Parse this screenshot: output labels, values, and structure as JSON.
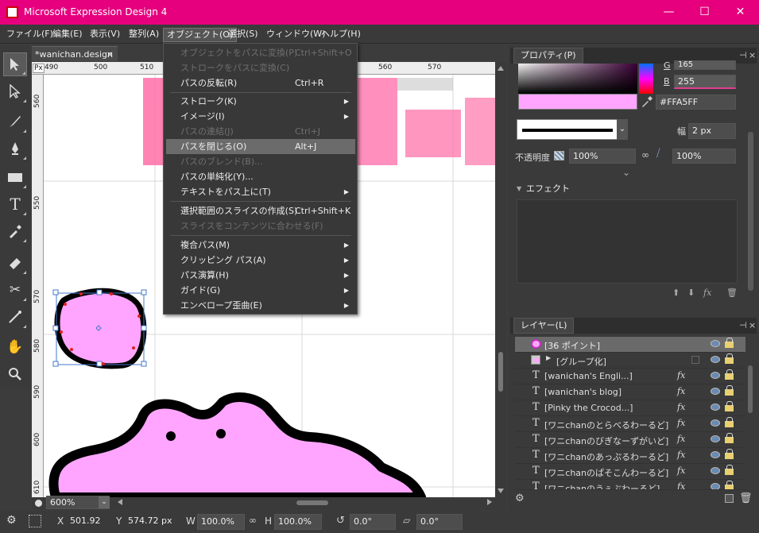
{
  "window": {
    "title": "Microsoft Expression Design 4",
    "minimize": "—",
    "maximize": "☐",
    "close": "✕"
  },
  "menu": [
    "ファイル(F)",
    "編集(E)",
    "表示(V)",
    "整列(A)",
    "オブジェクト(O)",
    "選択(S)",
    "ウィンドウ(W)",
    "ヘルプ(H)"
  ],
  "document": {
    "tab": "*wanichan.design",
    "close": "×",
    "ruler_origin": "Px"
  },
  "ruler_h": [
    "490",
    "500",
    "510",
    "560",
    "570"
  ],
  "ruler_v": [
    "560",
    "550",
    "570",
    "580",
    "590",
    "600",
    "610"
  ],
  "dropdown": {
    "items": [
      {
        "label": "オブジェクトをパスに変換(P)",
        "shortcut": "Ctrl+Shift+O",
        "disabled": true
      },
      {
        "label": "ストロークをパスに変換(C)",
        "shortcut": "",
        "disabled": true
      },
      {
        "label": "パスの反転(R)",
        "shortcut": "Ctrl+R",
        "disabled": false
      },
      {
        "label": "ストローク(K)",
        "shortcut": "",
        "disabled": false,
        "submenu": true
      },
      {
        "label": "イメージ(I)",
        "shortcut": "",
        "disabled": false,
        "submenu": true
      },
      {
        "label": "パスの連結(J)",
        "shortcut": "Ctrl+J",
        "disabled": true
      },
      {
        "label": "パスを閉じる(O)",
        "shortcut": "Alt+J",
        "disabled": false,
        "highlighted": true
      },
      {
        "label": "パスのブレンド(B)...",
        "shortcut": "",
        "disabled": true
      },
      {
        "label": "パスの単純化(Y)...",
        "shortcut": "",
        "disabled": false
      },
      {
        "label": "テキストをパス上に(T)",
        "shortcut": "",
        "disabled": false,
        "submenu": true
      },
      {
        "label": "選択範囲のスライスの作成(S)",
        "shortcut": "Ctrl+Shift+K",
        "disabled": false
      },
      {
        "label": "スライスをコンテンツに合わせる(F)",
        "shortcut": "",
        "disabled": true
      },
      {
        "label": "複合パス(M)",
        "shortcut": "",
        "disabled": false,
        "submenu": true
      },
      {
        "label": "クリッピング パス(A)",
        "shortcut": "",
        "disabled": false,
        "submenu": true
      },
      {
        "label": "パス演算(H)",
        "shortcut": "",
        "disabled": false,
        "submenu": true
      },
      {
        "label": "ガイド(G)",
        "shortcut": "",
        "disabled": false,
        "submenu": true
      },
      {
        "label": "エンベロープ歪曲(E)",
        "shortcut": "",
        "disabled": false,
        "submenu": true
      }
    ],
    "submenu_arrow": "▶"
  },
  "properties": {
    "title": "プロパティ(P)",
    "g_label": "G",
    "g_value": "165",
    "b_label": "B",
    "b_value": "255",
    "hex": "#FFA5FF",
    "width_label": "幅",
    "width_value": "2 px",
    "opacity_label": "不透明度",
    "opacity_value": "100%",
    "opacity2_value": "100%",
    "fill_color": "#FFA5FF"
  },
  "effects": {
    "title": "エフェクト",
    "fx": "fx"
  },
  "layers": {
    "title": "レイヤー(L)",
    "rows": [
      {
        "name": "[36 ポイント]",
        "type": "shape",
        "fx": ""
      },
      {
        "name": "[グループ化]",
        "type": "group",
        "fx": ""
      },
      {
        "name": "[wanichan's Engli...]",
        "type": "text",
        "fx": "fx"
      },
      {
        "name": "[wanichan's blog]",
        "type": "text",
        "fx": "fx"
      },
      {
        "name": "[Pinky the Crocod...]",
        "type": "text",
        "fx": "fx"
      },
      {
        "name": "[ワニchanのとらべるわーるど]",
        "type": "text",
        "fx": "fx"
      },
      {
        "name": "[ワニchanのびぎなーずがいど]",
        "type": "text",
        "fx": "fx"
      },
      {
        "name": "[ワニchanのあっぷるわーるど]",
        "type": "text",
        "fx": "fx"
      },
      {
        "name": "[ワニchanのぱそこんわーるど]",
        "type": "text",
        "fx": "fx"
      },
      {
        "name": "[ワニchanのうぇぶわーるど]",
        "type": "text",
        "fx": "fx"
      }
    ],
    "text_glyph": "T"
  },
  "statusbar": {
    "zoom": "600%",
    "x_label": "X",
    "x_value": "501.92 px",
    "y_label": "Y",
    "y_value": "574.72 px",
    "w_label": "W",
    "w_value": "100.0%",
    "h_label": "H",
    "h_value": "100.0%",
    "rot_value": "0.0°",
    "skew_value": "0.0°"
  },
  "colors": {
    "titlebar": "#e6007e",
    "pink": "#ff6fa8",
    "fill": "#ffa5ff"
  }
}
